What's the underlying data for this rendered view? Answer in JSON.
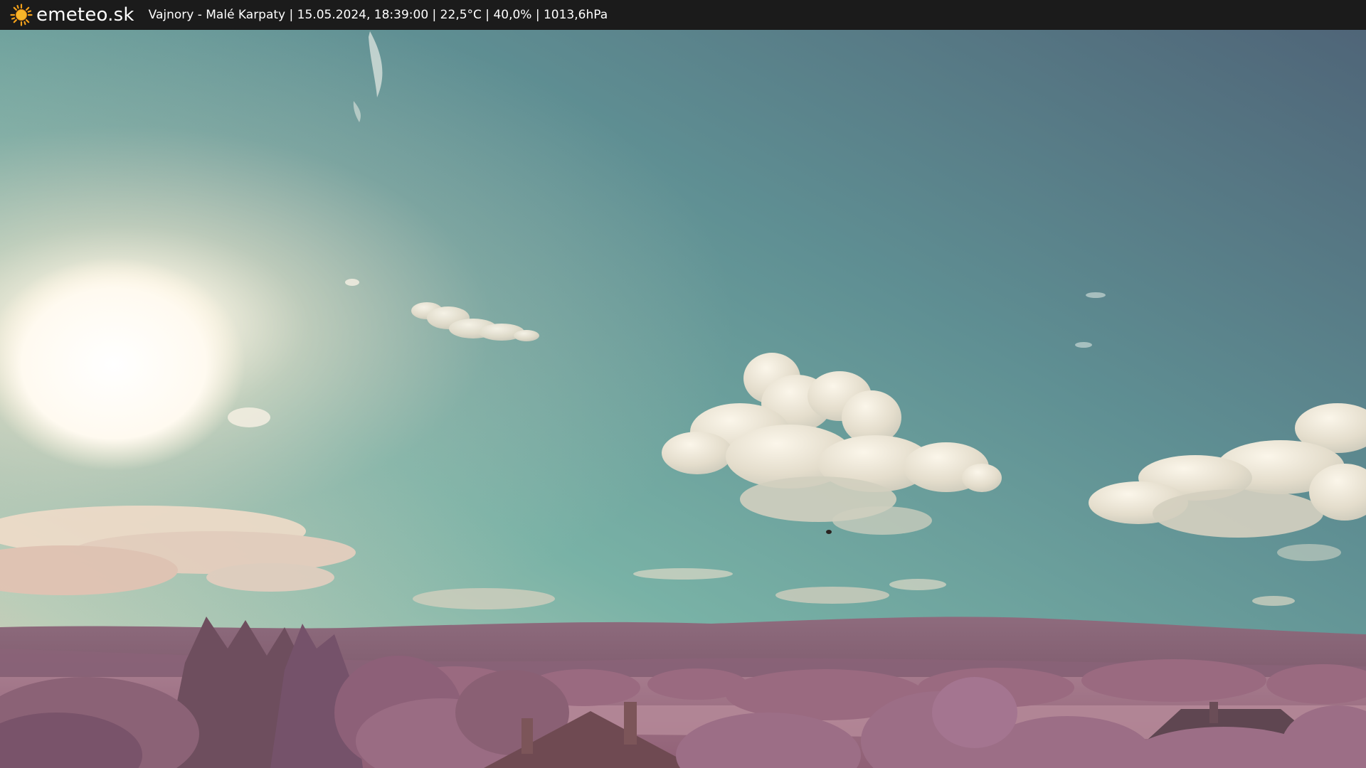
{
  "header": {
    "brand": "emeteo.sk",
    "readout": "Vajnory - Malé Karpaty | 15.05.2024, 18:39:00 | 22,5°C | 40,0% | 1013,6hPa",
    "logo_icon": "sun-icon",
    "background": "#1b1b1b",
    "text_color": "#ffffff"
  },
  "scene": {
    "sky_top_right": "#4f6a7c",
    "sky_mid": "#6fa7a0",
    "sky_horizon": "#e7c6b0",
    "ground_tint": "#a86f86"
  }
}
